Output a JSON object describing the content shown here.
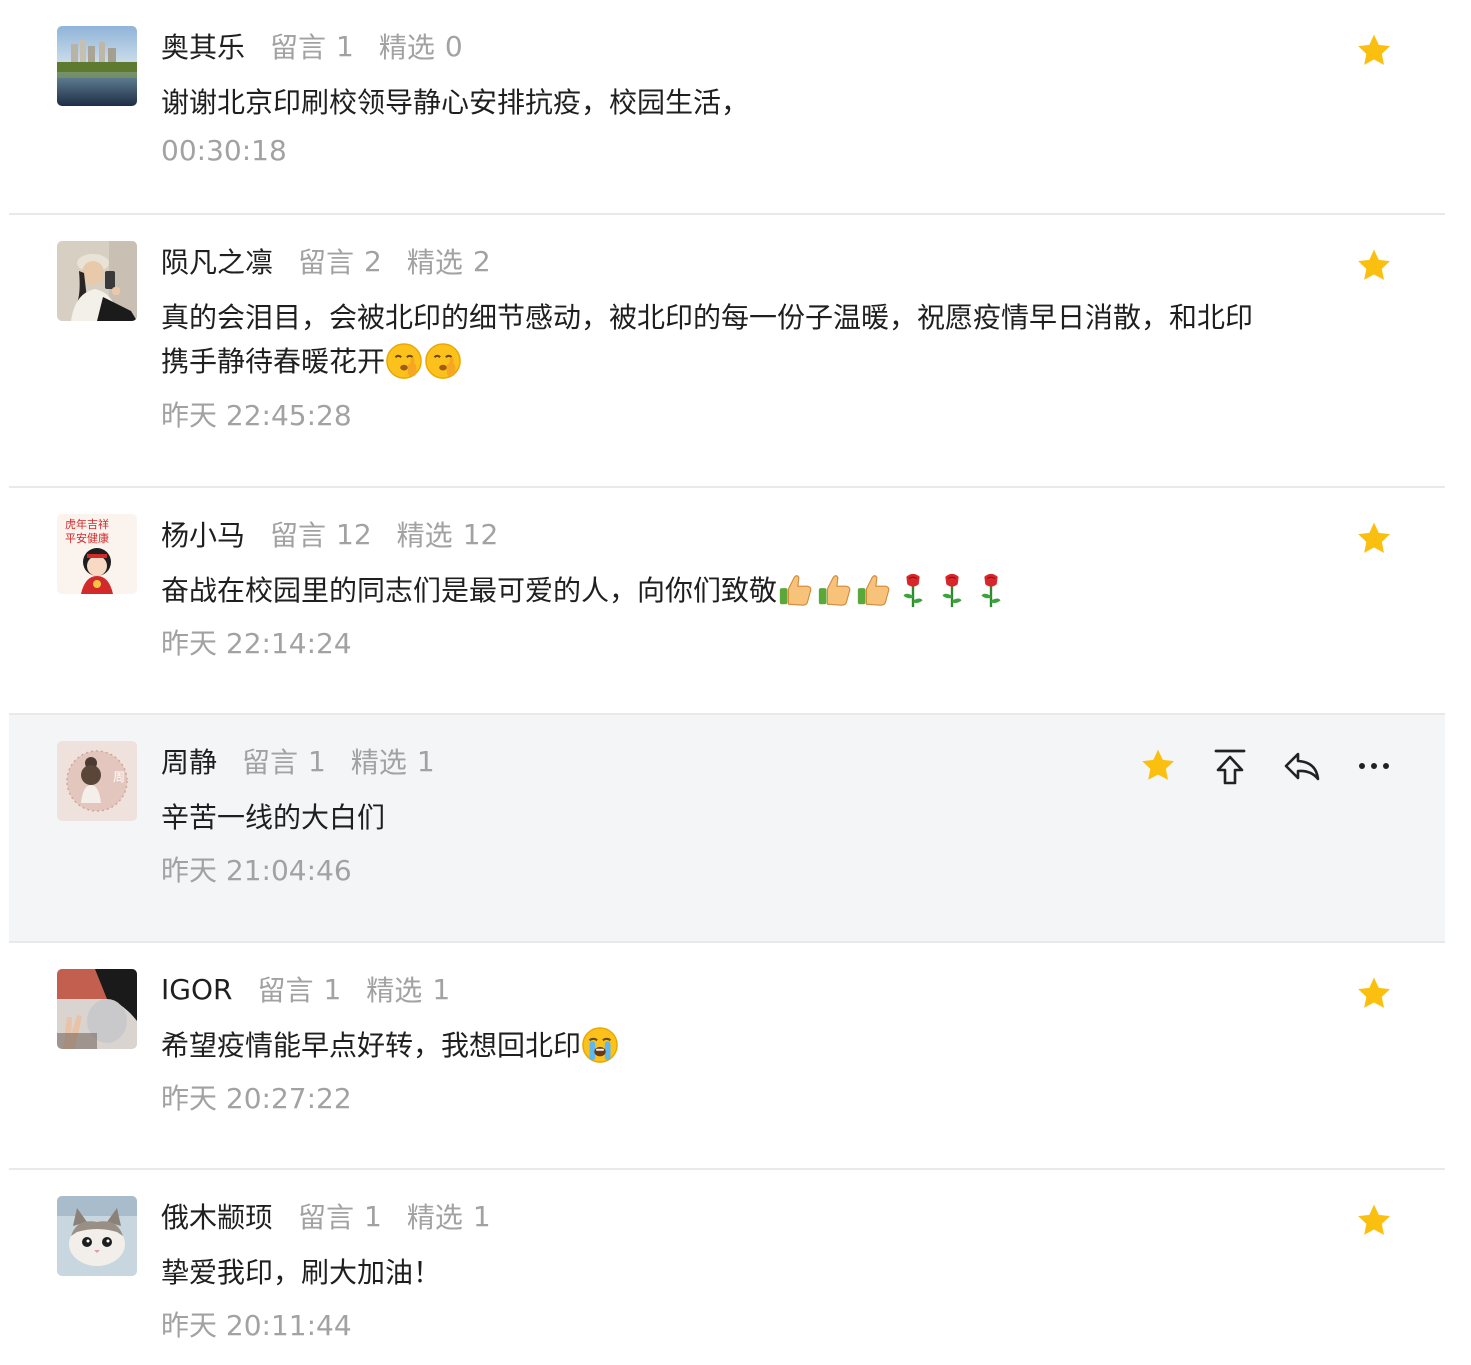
{
  "labels": {
    "liuyan": "留言",
    "jingxuan": "精选"
  },
  "colors": {
    "star": "#fbbf0f",
    "muted_text": "#a2a2a2",
    "primary_text": "#1f1f1f",
    "hover_background": "#f4f5f7",
    "divider": "#e9e9ea"
  },
  "comments": [
    {
      "nickname": "奥其乐",
      "liuyan_count": "1",
      "jingxuan_count": "0",
      "content": "谢谢北京印刷校领导静心安排抗疫，校园生活，",
      "time": "00:30:18",
      "avatar": "city-skyline-lake-avatar",
      "emojis": []
    },
    {
      "nickname": "陨凡之凛",
      "liuyan_count": "2",
      "jingxuan_count": "2",
      "content": "真的会泪目，会被北印的细节感动，被北印的每一份子温暖，祝愿疫情早日消散，和北印携手静待春暖花开",
      "time": "昨天 22:45:28",
      "avatar": "girl-selfie-avatar",
      "emojis": [
        "shushing-face",
        "shushing-face"
      ]
    },
    {
      "nickname": "杨小马",
      "liuyan_count": "12",
      "jingxuan_count": "12",
      "content": "奋战在校园里的同志们是最可爱的人，向你们致敬",
      "time": "昨天 22:14:24",
      "avatar": "new-year-girl-avatar",
      "emojis": [
        "thumbs-up",
        "thumbs-up",
        "thumbs-up",
        "rose",
        "rose",
        "rose"
      ]
    },
    {
      "nickname": "周静",
      "liuyan_count": "1",
      "jingxuan_count": "1",
      "content": "辛苦一线的大白们",
      "time": "昨天 21:04:46",
      "avatar": "girl-bun-badge-avatar",
      "avatar_badge": "周",
      "emojis": []
    },
    {
      "nickname": "IGOR",
      "liuyan_count": "1",
      "jingxuan_count": "1",
      "content": "希望疫情能早点好转，我想回北印",
      "time": "昨天 20:27:22",
      "avatar": "peace-sign-avatar",
      "emojis": [
        "loudly-crying-face"
      ]
    },
    {
      "nickname": "俄木颛顼",
      "liuyan_count": "1",
      "jingxuan_count": "1",
      "content": "挚爱我印，刷大加油！",
      "time": "昨天 20:11:44",
      "avatar": "kitten-avatar",
      "emojis": []
    }
  ]
}
